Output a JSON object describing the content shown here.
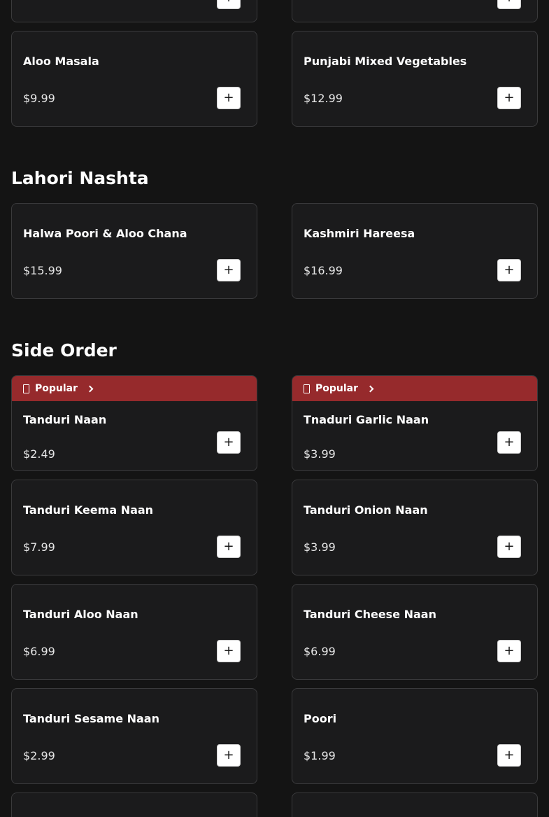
{
  "add_button_label": "+",
  "popular_label": "Popular",
  "sections": {
    "prev": {
      "items": [
        {
          "name": "",
          "price": ""
        },
        {
          "name": "",
          "price": ""
        },
        {
          "name": "Aloo Masala",
          "price": "$9.99"
        },
        {
          "name": "Punjabi Mixed Vegetables",
          "price": "$12.99"
        }
      ]
    },
    "lahori": {
      "title": "Lahori Nashta",
      "items": [
        {
          "name": "Halwa Poori & Aloo Chana",
          "price": "$15.99"
        },
        {
          "name": "Kashmiri Hareesa",
          "price": "$16.99"
        }
      ]
    },
    "side": {
      "title": "Side Order",
      "items": [
        {
          "name": "Tanduri Naan",
          "price": "$2.49",
          "popular": true
        },
        {
          "name": "Tnaduri Garlic Naan",
          "price": "$3.99",
          "popular": true
        },
        {
          "name": "Tanduri Keema Naan",
          "price": "$7.99"
        },
        {
          "name": "Tanduri Onion Naan",
          "price": "$3.99"
        },
        {
          "name": "Tanduri Aloo Naan",
          "price": "$6.99"
        },
        {
          "name": "Tanduri Cheese Naan",
          "price": "$6.99"
        },
        {
          "name": "Tanduri Sesame Naan",
          "price": "$2.99"
        },
        {
          "name": "Poori",
          "price": "$1.99"
        },
        {
          "name": "",
          "price": ""
        },
        {
          "name": "",
          "price": ""
        }
      ]
    }
  },
  "colors": {
    "background": "#141414",
    "card": "#1b1b1c",
    "card_border": "#3a3a3c",
    "popular_bar": "#962a2c"
  }
}
